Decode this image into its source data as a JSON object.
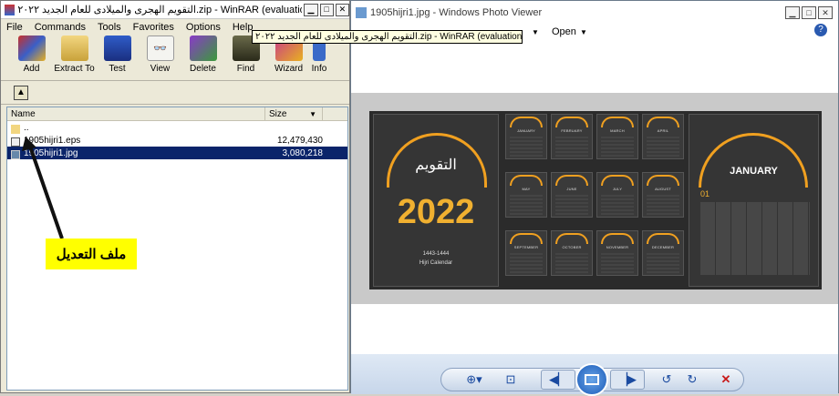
{
  "winrar": {
    "title": "التقويم الهجرى والميلادى للعام الجديد ٢٠٢٢.zip - WinRAR (evaluation copy)",
    "menu": [
      "File",
      "Commands",
      "Tools",
      "Favorites",
      "Options",
      "Help"
    ],
    "tools": [
      {
        "label": "Add",
        "icon": "add-archive-icon"
      },
      {
        "label": "Extract To",
        "icon": "extract-folder-icon"
      },
      {
        "label": "Test",
        "icon": "test-book-icon"
      },
      {
        "label": "View",
        "icon": "view-glasses-icon"
      },
      {
        "label": "Delete",
        "icon": "delete-book-icon"
      },
      {
        "label": "Find",
        "icon": "binoculars-icon"
      },
      {
        "label": "Wizard",
        "icon": "wizard-icon"
      },
      {
        "label": "Info",
        "icon": "info-icon"
      }
    ],
    "columns": {
      "name": "Name",
      "size": "Size"
    },
    "files": [
      {
        "name": "..",
        "size": ""
      },
      {
        "name": "1905hijri1.eps",
        "size": "12,479,430"
      },
      {
        "name": "1905hijri1.jpg",
        "size": "3,080,218"
      }
    ],
    "tooltip": "التقويم الهجرى والميلادى للعام الجديد ٢٠٢٢.zip - WinRAR (evaluation copy)"
  },
  "annotation": {
    "text": "ملف التعديل",
    "color": "#ffff00"
  },
  "viewer": {
    "title": "1905hijri1.jpg - Windows Photo Viewer",
    "menu_open": "Open",
    "calendar": {
      "left_title": "التقويم",
      "year": "2022",
      "hijri_years": "1443-1444",
      "caption": "Hijri Calendar",
      "months": [
        "JANUARY",
        "FEBRUARY",
        "MARCH",
        "APRIL",
        "MAY",
        "JUNE",
        "JULY",
        "AUGUST",
        "SEPTEMBER",
        "OCTOBER",
        "NOVEMBER",
        "DECEMBER"
      ],
      "featured_month": "JANUARY",
      "featured_number": "01"
    },
    "accent": "#f0b030"
  }
}
